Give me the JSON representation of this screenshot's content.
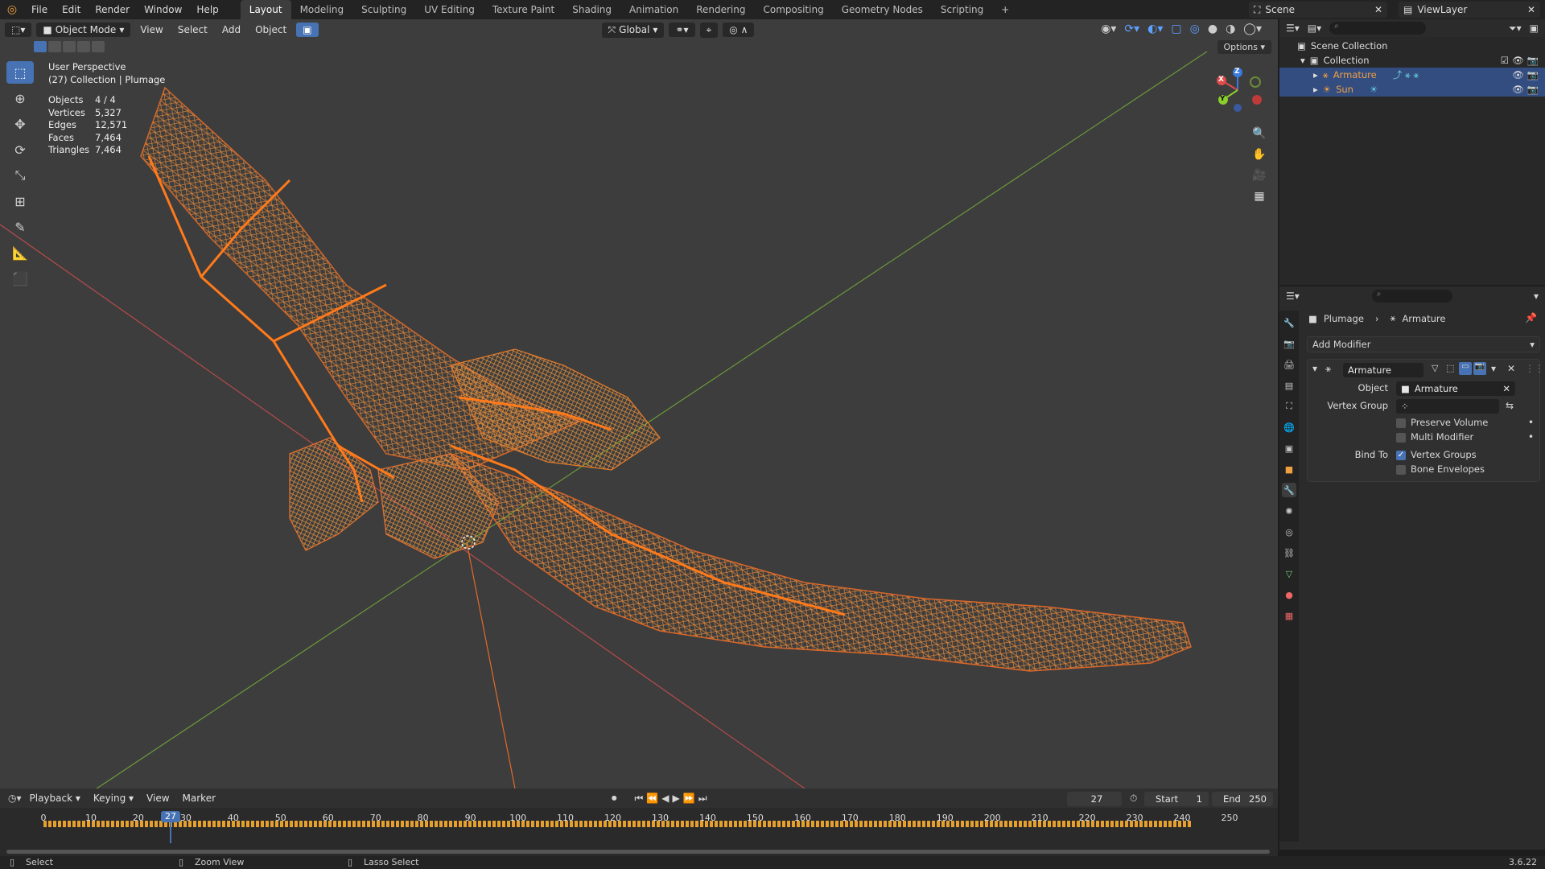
{
  "menu": [
    "File",
    "Edit",
    "Render",
    "Window",
    "Help"
  ],
  "workspaces": [
    "Layout",
    "Modeling",
    "Sculpting",
    "UV Editing",
    "Texture Paint",
    "Shading",
    "Animation",
    "Rendering",
    "Compositing",
    "Geometry Nodes",
    "Scripting"
  ],
  "active_workspace": "Layout",
  "scene_name": "Scene",
  "view_layer": "ViewLayer",
  "viewport": {
    "mode": "Object Mode",
    "menus": [
      "View",
      "Select",
      "Add",
      "Object"
    ],
    "orientation": "Global",
    "options_label": "Options",
    "perspective": "User Perspective",
    "collection_line": "(27) Collection | Plumage",
    "stats": [
      {
        "k": "Objects",
        "v": "4 / 4"
      },
      {
        "k": "Vertices",
        "v": "5,327"
      },
      {
        "k": "Edges",
        "v": "12,571"
      },
      {
        "k": "Faces",
        "v": "7,464"
      },
      {
        "k": "Triangles",
        "v": "7,464"
      }
    ],
    "gizmo": {
      "x": "X",
      "y": "Y",
      "z": "Z"
    }
  },
  "outliner": {
    "scene_collection": "Scene Collection",
    "collection": "Collection",
    "items": [
      "Armature",
      "Sun"
    ]
  },
  "properties": {
    "breadcrumb_object": "Plumage",
    "breadcrumb_data": "Armature",
    "add_modifier": "Add Modifier",
    "modifier_name": "Armature",
    "object_label": "Object",
    "object_value": "Armature",
    "vertex_group_label": "Vertex Group",
    "preserve_volume": "Preserve Volume",
    "multi_modifier": "Multi Modifier",
    "bind_to_label": "Bind To",
    "vertex_groups": "Vertex Groups",
    "bone_envelopes": "Bone Envelopes",
    "vertex_groups_checked": true
  },
  "timeline": {
    "menus": [
      "Playback",
      "Keying",
      "View",
      "Marker"
    ],
    "current_frame": "27",
    "start_label": "Start",
    "start": "1",
    "end_label": "End",
    "end": "250",
    "ticks": [
      "0",
      "10",
      "20",
      "30",
      "40",
      "50",
      "60",
      "70",
      "80",
      "90",
      "100",
      "110",
      "120",
      "130",
      "140",
      "150",
      "160",
      "170",
      "180",
      "190",
      "200",
      "210",
      "220",
      "230",
      "240",
      "250"
    ]
  },
  "status": {
    "select": "Select",
    "zoom": "Zoom View",
    "lasso": "Lasso Select",
    "version": "3.6.22"
  },
  "colors": {
    "accent": "#4772b3",
    "wire": "#e07a2a",
    "bone": "#ff7a1a",
    "selected_row": "#334d80"
  }
}
